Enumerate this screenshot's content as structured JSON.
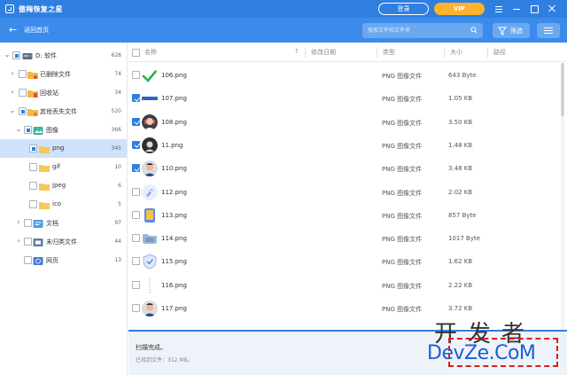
{
  "app": {
    "title": "傲梅恢复之星",
    "login_label": "登录",
    "vip_label": "VIP"
  },
  "toolbar": {
    "back_label": "返回首页",
    "search_placeholder": "搜索文件和文件夹",
    "filter_label": "筛选"
  },
  "tree": [
    {
      "label": "D: 软件",
      "count": "628",
      "icon": "drive-icon",
      "expanded": true,
      "check": "partial"
    },
    {
      "label": "已删除文件",
      "count": "74",
      "icon": "deleted-folder-icon",
      "expanded": false,
      "check": "none"
    },
    {
      "label": "回收站",
      "count": "34",
      "icon": "recycle-bin-icon",
      "expanded": false,
      "check": "none"
    },
    {
      "label": "其他丢失文件",
      "count": "520",
      "icon": "lost-folder-icon",
      "expanded": true,
      "check": "partial"
    },
    {
      "label": "图像",
      "count": "366",
      "icon": "image-category-icon",
      "expanded": true,
      "check": "partial"
    },
    {
      "label": "png",
      "count": "345",
      "icon": "folder-icon",
      "selected": true,
      "check": "partial"
    },
    {
      "label": "gif",
      "count": "10",
      "icon": "folder-icon",
      "check": "none"
    },
    {
      "label": "jpeg",
      "count": "6",
      "icon": "folder-icon",
      "check": "none"
    },
    {
      "label": "ico",
      "count": "5",
      "icon": "folder-icon",
      "check": "none"
    },
    {
      "label": "文档",
      "count": "97",
      "icon": "document-category-icon",
      "expanded": false,
      "check": "none"
    },
    {
      "label": "未归类文件",
      "count": "44",
      "icon": "unclassified-category-icon",
      "expanded": false,
      "check": "none"
    },
    {
      "label": "网页",
      "count": "13",
      "icon": "webpage-category-icon",
      "check": "none"
    }
  ],
  "columns": {
    "name": "名称",
    "modified": "修改日期",
    "type": "类型",
    "size": "大小",
    "path": "路径"
  },
  "files": [
    {
      "name": "106.png",
      "type": "PNG 图像文件",
      "size": "643 Byte",
      "checked": false,
      "thumb": "green-check-thumbnail"
    },
    {
      "name": "107.png",
      "type": "PNG 图像文件",
      "size": "1.05 KB",
      "checked": true,
      "thumb": "blue-bar-thumbnail"
    },
    {
      "name": "108.png",
      "type": "PNG 图像文件",
      "size": "3.50 KB",
      "checked": true,
      "thumb": "headset-avatar-thumbnail"
    },
    {
      "name": "11.png",
      "type": "PNG 图像文件",
      "size": "1.48 KB",
      "checked": true,
      "thumb": "dark-circle-thumbnail"
    },
    {
      "name": "110.png",
      "type": "PNG 图像文件",
      "size": "3.48 KB",
      "checked": true,
      "thumb": "person-photo-thumbnail"
    },
    {
      "name": "112.png",
      "type": "PNG 图像文件",
      "size": "2.02 KB",
      "checked": false,
      "thumb": "rocket-thumbnail"
    },
    {
      "name": "113.png",
      "type": "PNG 图像文件",
      "size": "857 Byte",
      "checked": false,
      "thumb": "book-thumbnail"
    },
    {
      "name": "114.png",
      "type": "PNG 图像文件",
      "size": "1017 Byte",
      "checked": false,
      "thumb": "folder-thumbnail"
    },
    {
      "name": "115.png",
      "type": "PNG 图像文件",
      "size": "1.62 KB",
      "checked": false,
      "thumb": "shield-thumbnail"
    },
    {
      "name": "116.png",
      "type": "PNG 图像文件",
      "size": "2.22 KB",
      "checked": false,
      "thumb": "dotted-line-thumbnail"
    },
    {
      "name": "117.png",
      "type": "PNG 图像文件",
      "size": "3.72 KB",
      "checked": false,
      "thumb": "person-photo-thumbnail"
    }
  ],
  "status": {
    "title": "扫描完成。",
    "found": "已找到文件：312 MB。"
  },
  "watermark": {
    "top_text": "开发者",
    "bottom_text": "DevZe.CoM"
  },
  "colors": {
    "titlebar": "#2f7fe0",
    "toolbar": "#3b8bea",
    "accent": "#2f7fe0",
    "vip": "#ffb22a",
    "selected_row": "#cfe2fb"
  }
}
